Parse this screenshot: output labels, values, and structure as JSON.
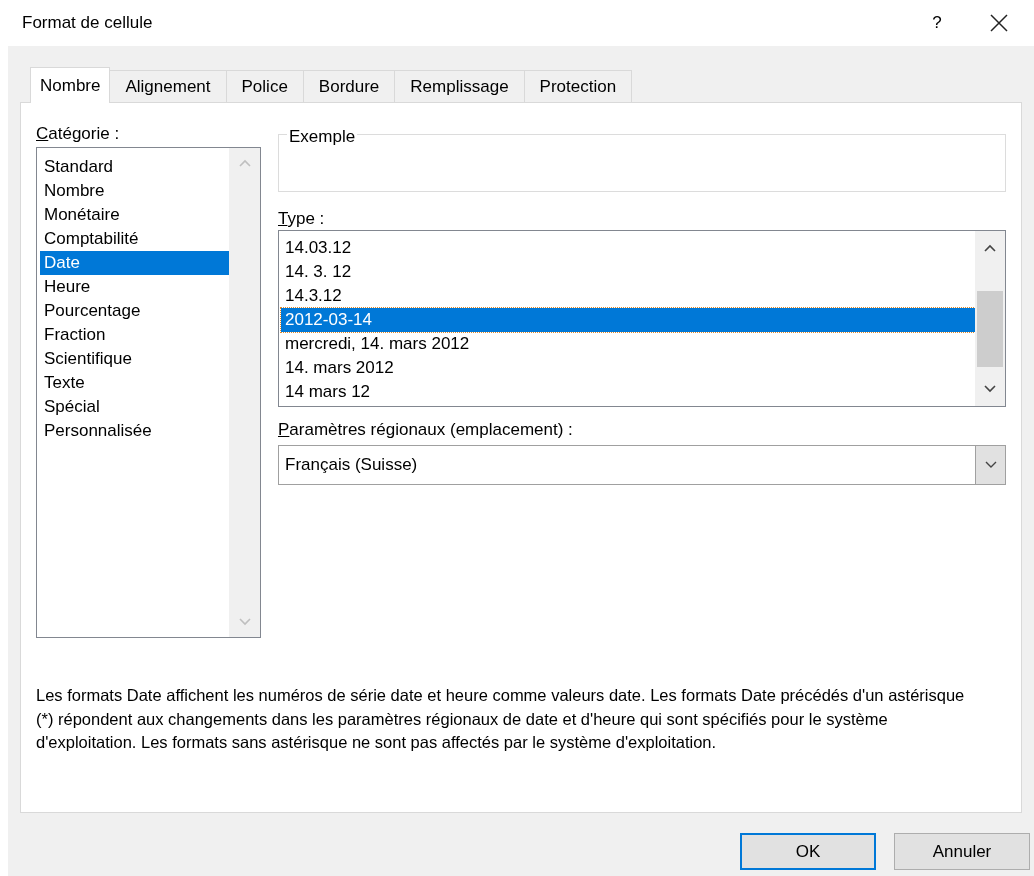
{
  "window": {
    "title": "Format de cellule",
    "help": "?"
  },
  "tabs": [
    {
      "label": "Nombre",
      "selected": true
    },
    {
      "label": "Alignement",
      "selected": false
    },
    {
      "label": "Police",
      "selected": false
    },
    {
      "label": "Bordure",
      "selected": false
    },
    {
      "label": "Remplissage",
      "selected": false
    },
    {
      "label": "Protection",
      "selected": false
    }
  ],
  "category": {
    "label": "Catégorie :",
    "items": [
      {
        "label": "Standard",
        "selected": false
      },
      {
        "label": "Nombre",
        "selected": false
      },
      {
        "label": "Monétaire",
        "selected": false
      },
      {
        "label": "Comptabilité",
        "selected": false
      },
      {
        "label": "Date",
        "selected": true
      },
      {
        "label": "Heure",
        "selected": false
      },
      {
        "label": "Pourcentage",
        "selected": false
      },
      {
        "label": "Fraction",
        "selected": false
      },
      {
        "label": "Scientifique",
        "selected": false
      },
      {
        "label": "Texte",
        "selected": false
      },
      {
        "label": "Spécial",
        "selected": false
      },
      {
        "label": "Personnalisée",
        "selected": false
      }
    ]
  },
  "example": {
    "label": "Exemple"
  },
  "type": {
    "label": "Type :",
    "items": [
      {
        "label": "14.03.12",
        "selected": false
      },
      {
        "label": "14. 3. 12",
        "selected": false
      },
      {
        "label": "14.3.12",
        "selected": false
      },
      {
        "label": "2012-03-14",
        "selected": true
      },
      {
        "label": "mercredi, 14. mars 2012",
        "selected": false
      },
      {
        "label": "14. mars 2012",
        "selected": false
      },
      {
        "label": "14 mars 12",
        "selected": false
      }
    ]
  },
  "locale": {
    "label": "Paramètres régionaux (emplacement) :",
    "value": "Français (Suisse)"
  },
  "description": "Les formats Date affichent les numéros de série date et heure comme valeurs date. Les formats Date précédés d'un astérisque (*) répondent aux changements dans les paramètres régionaux de date et d'heure qui sont spécifiés pour le système d'exploitation. Les formats sans astérisque ne sont pas affectés par le système d'exploitation.",
  "buttons": [
    {
      "label": "OK",
      "default": true
    },
    {
      "label": "Annuler",
      "default": false
    }
  ]
}
